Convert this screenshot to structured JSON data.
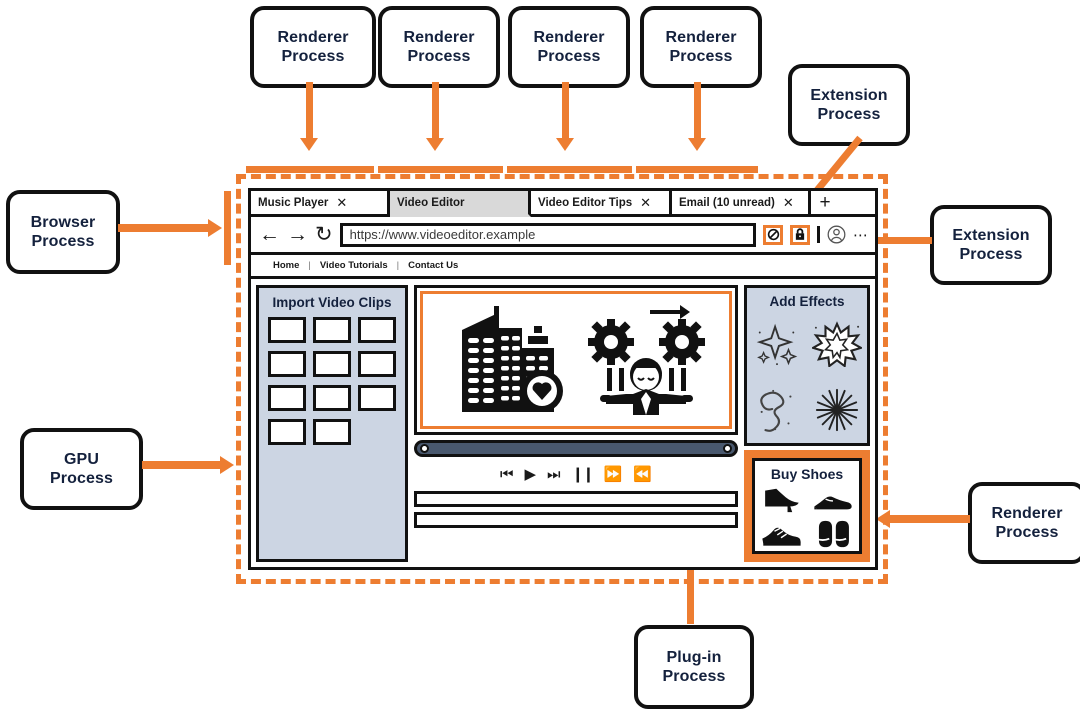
{
  "callouts": {
    "renderer_1": {
      "line1": "Renderer",
      "line2": "Process"
    },
    "renderer_2": {
      "line1": "Renderer",
      "line2": "Process"
    },
    "renderer_3": {
      "line1": "Renderer",
      "line2": "Process"
    },
    "renderer_4": {
      "line1": "Renderer",
      "line2": "Process"
    },
    "extension_top": {
      "line1": "Extension",
      "line2": "Process"
    },
    "extension_right": {
      "line1": "Extension",
      "line2": "Process"
    },
    "browser": {
      "line1": "Browser",
      "line2": "Process"
    },
    "gpu": {
      "line1": "GPU",
      "line2": "Process"
    },
    "renderer_right": {
      "line1": "Renderer",
      "line2": "Process"
    },
    "plugin": {
      "line1": "Plug-in",
      "line2": "Process"
    }
  },
  "colors": {
    "accent_orange": "#ED7D31",
    "panel_blue": "#CCD5E3",
    "active_tab_gray": "#D9D9D9",
    "scrubber_slate": "#49586E",
    "outline_black": "#111111"
  },
  "browser": {
    "tabs": [
      {
        "label": "Music Player",
        "close": "✕",
        "active": false
      },
      {
        "label": "Video Editor",
        "close": "",
        "active": true
      },
      {
        "label": "Video Editor Tips",
        "close": "✕",
        "active": false
      },
      {
        "label": "Email (10 unread)",
        "close": "✕",
        "active": false
      }
    ],
    "new_tab_label": "+",
    "toolbar": {
      "back": "←",
      "forward": "→",
      "reload": "↻",
      "url": "https://www.videoeditor.example",
      "block_icon": "block-icon",
      "lock_icon": "lock-icon",
      "profile_icon": "profile-icon",
      "overflow": "⋯"
    },
    "site_nav": {
      "items": [
        "Home",
        "Video Tutorials",
        "Contact Us"
      ],
      "separator": "|"
    }
  },
  "page": {
    "import_panel": {
      "title": "Import Video Clips",
      "thumbnail_count": 11
    },
    "video_player": {
      "transport": [
        {
          "name": "skip-back-button",
          "glyph": "⏮"
        },
        {
          "name": "play-button",
          "glyph": "▶"
        },
        {
          "name": "skip-forward-button",
          "glyph": "⏭"
        },
        {
          "name": "pause-button",
          "glyph": "❙❙"
        },
        {
          "name": "fast-forward-button",
          "glyph": "⏩"
        },
        {
          "name": "rewind-button",
          "glyph": "⏪"
        }
      ],
      "timeline_track_count": 2
    },
    "effects_panel": {
      "title": "Add Effects",
      "effects": [
        "sparkle-effect",
        "starburst-effect",
        "swirl-effect",
        "firework-effect"
      ]
    },
    "ad_panel": {
      "title": "Buy Shoes",
      "items": [
        "high-heel-shoe",
        "dress-shoe",
        "sneaker-shoe",
        "slippers"
      ]
    }
  }
}
